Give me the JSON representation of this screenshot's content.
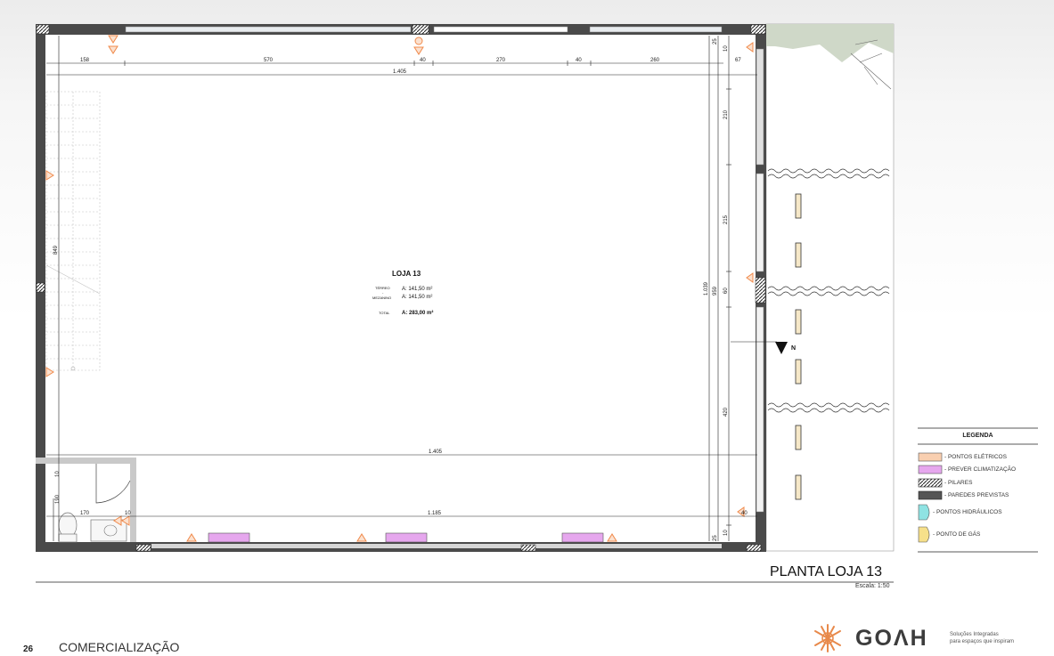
{
  "drawing": {
    "title": "PLANTA LOJA 13",
    "scale": "Escala: 1:50"
  },
  "room": {
    "name": "LOJA 13",
    "terreo_label": "TÉRREO",
    "mezanino_label": "MEZANINO",
    "terreo_area": "A: 141,50 m²",
    "mezanino_area": "A: 141,50 m²",
    "total_label": "TOTAL",
    "total_area": "A: 283,00 m²"
  },
  "dimensions": {
    "top_segments": [
      "158",
      "570",
      "40",
      "270",
      "40",
      "260"
    ],
    "top_side": "67",
    "top_total": "1.405",
    "middle_total": "1.405",
    "bottom_left": "170",
    "bottom_mid": "10",
    "bottom_total": "1.185",
    "bottom_side": "40",
    "left_height": "849",
    "bath_a": "10",
    "bath_b": "190",
    "right_total": "1.039",
    "right_inner": "959",
    "right_segments": [
      "25",
      "10",
      "210",
      "215",
      "60",
      "420",
      "10",
      "25"
    ]
  },
  "north": "N",
  "legend": {
    "title": "LEGENDA",
    "items": [
      {
        "label": "- PONTOS ELÉTRICOS",
        "color": "#f9cfb0"
      },
      {
        "label": "- PREVER CLIMATIZAÇÃO",
        "color": "#e6a7ee"
      },
      {
        "label": "- PILARES",
        "color": "#ffffff"
      },
      {
        "label": "- PAREDES PREVISTAS",
        "color": "#555555"
      },
      {
        "label": "- PONTOS HIDRÁULICOS",
        "color": "#8fe3e3"
      },
      {
        "label": "- PONTO DE GÁS",
        "color": "#f6e08a"
      }
    ]
  },
  "footer": {
    "page_number": "26",
    "section": "COMERCIALIZAÇÃO",
    "brand": "GOΛH",
    "tagline_1": "Soluções Integradas",
    "tagline_2": "para espaços que inspiram"
  },
  "colors": {
    "wall": "#4a4a4a",
    "electric": "#f08a4b",
    "climate": "#e6a7ee",
    "outdoor_green": "#cfd8c8"
  }
}
